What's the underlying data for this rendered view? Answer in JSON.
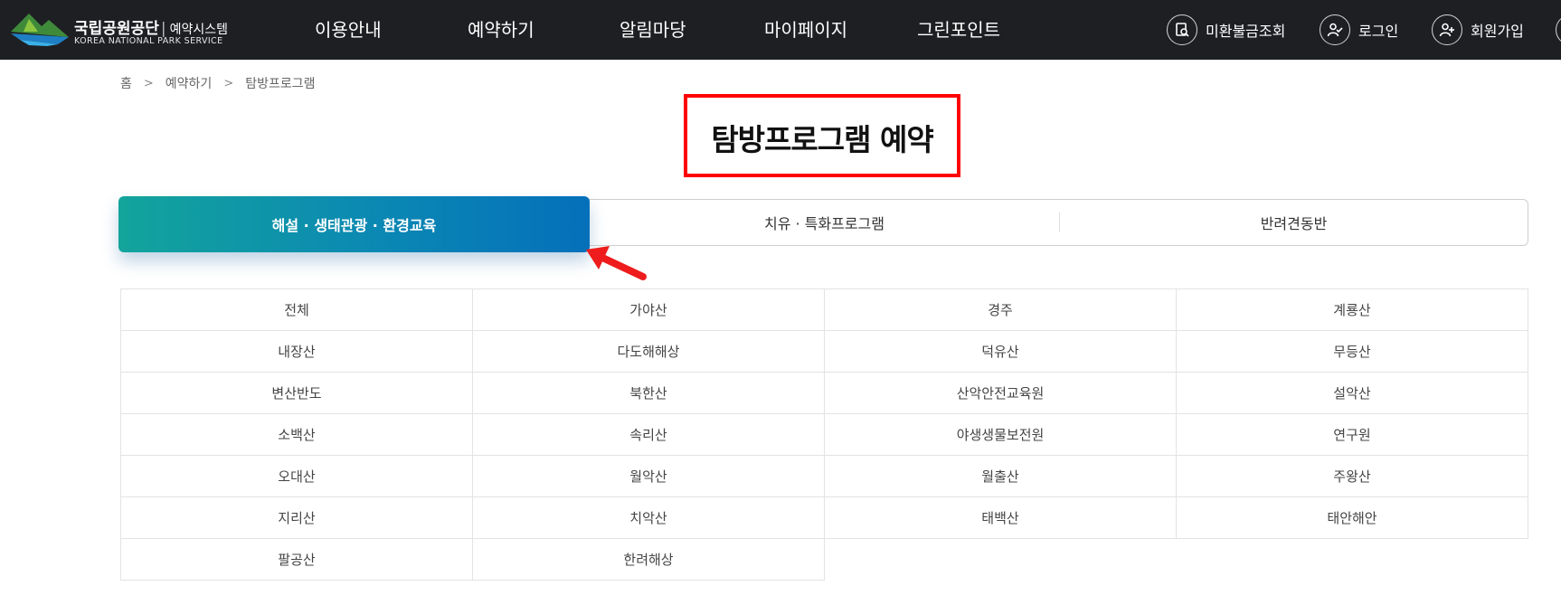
{
  "header": {
    "logo": {
      "name_ko": "국립공원공단",
      "system": "예약시스템",
      "name_en": "KOREA NATIONAL PARK SERVICE"
    },
    "nav": [
      "이용안내",
      "예약하기",
      "알림마당",
      "마이페이지",
      "그린포인트"
    ],
    "util": {
      "unpaid": "미환불금조회",
      "login": "로그인",
      "signup": "회원가입"
    }
  },
  "breadcrumb": {
    "home": "홈",
    "level1": "예약하기",
    "level2": "탐방프로그램"
  },
  "page_title": "탐방프로그램 예약",
  "tabs": [
    "해설 · 생태관광 · 환경교육",
    "치유 · 특화프로그램",
    "반려견동반"
  ],
  "active_tab": 0,
  "parks": [
    [
      "전체",
      "가야산",
      "경주",
      "계룡산"
    ],
    [
      "내장산",
      "다도해해상",
      "덕유산",
      "무등산"
    ],
    [
      "변산반도",
      "북한산",
      "산악안전교육원",
      "설악산"
    ],
    [
      "소백산",
      "속리산",
      "야생생물보전원",
      "연구원"
    ],
    [
      "오대산",
      "월악산",
      "월출산",
      "주왕산"
    ],
    [
      "지리산",
      "치악산",
      "태백산",
      "태안해안"
    ],
    [
      "팔공산",
      "한려해상"
    ]
  ],
  "colors": {
    "header_bg": "#1e1f23",
    "tab_gradient_start": "#13a49c",
    "tab_gradient_end": "#0470ba",
    "highlight": "#ff0000"
  }
}
